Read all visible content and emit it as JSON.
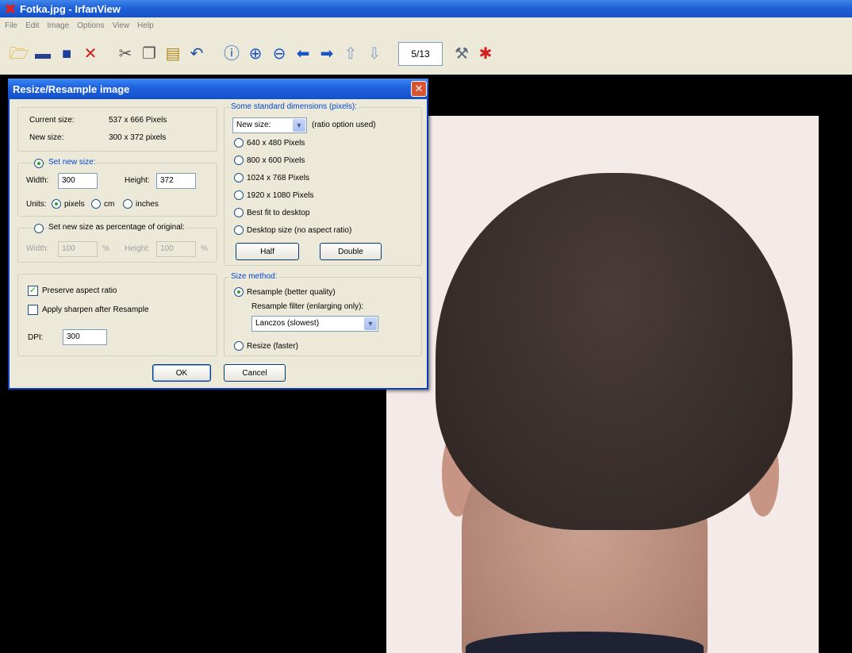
{
  "window": {
    "title": "Fotka.jpg - IrfanView",
    "menu": [
      "File",
      "Edit",
      "Image",
      "Options",
      "View",
      "Help"
    ],
    "page_indicator": "5/13"
  },
  "toolbar_icons": [
    "open-folder-icon",
    "slideshow-icon",
    "save-icon",
    "delete-icon",
    "cut-icon",
    "copy-icon",
    "paste-icon",
    "undo-icon",
    "info-icon",
    "zoom-in-icon",
    "zoom-out-icon",
    "prev-arrow-icon",
    "next-arrow-icon",
    "first-page-icon",
    "last-page-icon",
    "settings-icon",
    "irfanview-logo-icon"
  ],
  "dialog": {
    "title": "Resize/Resample image",
    "close": "✕",
    "current_size_label": "Current size:",
    "current_size_value": "537 x 666 Pixels",
    "new_size_label": "New size:",
    "new_size_value": "300 x 372 pixels",
    "set_new_size": {
      "label": "Set new size:",
      "width_label": "Width:",
      "width_value": "300",
      "height_label": "Height:",
      "height_value": "372",
      "units_label": "Units:",
      "units": [
        "pixels",
        "cm",
        "inches"
      ]
    },
    "percentage": {
      "label": "Set new size as percentage of original:",
      "width_label": "Width:",
      "width_value": "100",
      "height_label": "Height:",
      "height_value": "100",
      "pct": "%"
    },
    "preserve_aspect": "Preserve aspect ratio",
    "apply_sharpen": "Apply sharpen after Resample",
    "dpi_label": "DPI:",
    "dpi_value": "300",
    "standard": {
      "title": "Some standard dimensions (pixels):",
      "select_value": "New size:",
      "select_note": "(ratio option used)",
      "options": [
        "640 x 480 Pixels",
        "800 x 600 Pixels",
        "1024 x 768 Pixels",
        "1920 x 1080 Pixels",
        "Best fit to desktop",
        "Desktop size (no aspect ratio)"
      ],
      "half": "Half",
      "double": "Double"
    },
    "method": {
      "title": "Size method:",
      "resample": "Resample (better quality)",
      "filter_label": "Resample filter (enlarging only):",
      "filter_value": "Lanczos (slowest)",
      "resize": "Resize (faster)"
    },
    "ok": "OK",
    "cancel": "Cancel"
  }
}
